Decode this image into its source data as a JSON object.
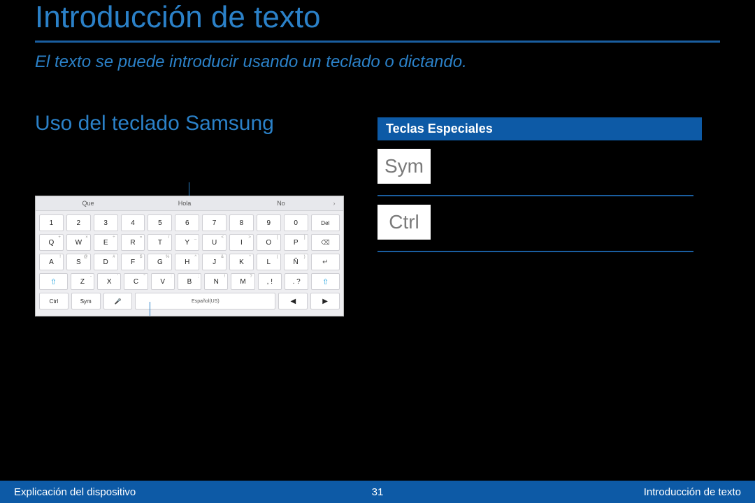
{
  "title": "Introducción de texto",
  "subtitle": "El texto se puede introducir usando un teclado o dictando.",
  "section": "Uso del teclado Samsung",
  "teclas_header": "Teclas Especiales",
  "special_keys": {
    "sym": "Sym",
    "ctrl": "Ctrl"
  },
  "keyboard": {
    "suggestions": [
      "Que",
      "Hola",
      "No",
      "›"
    ],
    "row1": [
      "1",
      "2",
      "3",
      "4",
      "5",
      "6",
      "7",
      "8",
      "9",
      "0",
      "Del"
    ],
    "row2": {
      "keys": [
        "Q",
        "W",
        "E",
        "R",
        "T",
        "Y",
        "U",
        "I",
        "O",
        "P"
      ],
      "sup": [
        "+",
        "×",
        "÷",
        "=",
        "/",
        "_",
        "<",
        ">",
        "[",
        "]"
      ]
    },
    "row3": {
      "keys": [
        "A",
        "S",
        "D",
        "F",
        "G",
        "H",
        "J",
        "K",
        "L",
        "Ñ"
      ],
      "sup": [
        "!",
        "@",
        "#",
        "$",
        "%",
        "^",
        "&",
        "*",
        "(",
        ")"
      ]
    },
    "row4": {
      "shift": "⇧",
      "keys": [
        "Z",
        "X",
        "C",
        "V",
        "B",
        "N",
        "M",
        ", !",
        ". ?"
      ],
      "sup": [
        "-",
        "'",
        "\"",
        ":",
        ";",
        "!",
        "?",
        "",
        ""
      ],
      "shift2": "⇧"
    },
    "row5": {
      "ctrl": "Ctrl",
      "sym": "Sym",
      "mic": "🎤",
      "space": "Español(US)",
      "left": "◀",
      "right": "▶"
    },
    "backspace": "⌫",
    "enter": "↵"
  },
  "footer": {
    "left": "Explicación del dispositivo",
    "page": "31",
    "right": "Introducción de texto"
  }
}
